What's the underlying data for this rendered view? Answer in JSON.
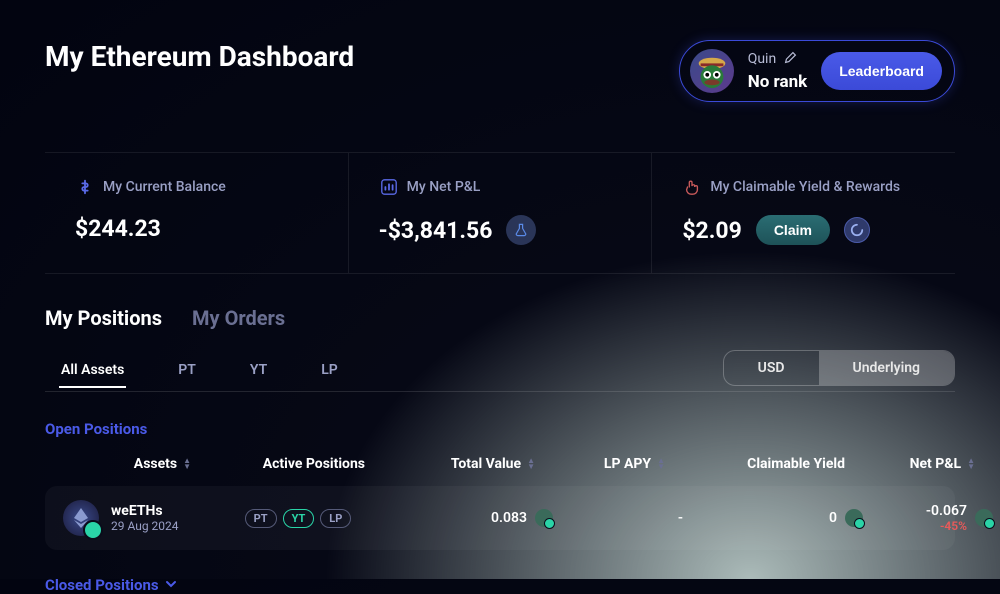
{
  "header": {
    "title": "My Ethereum Dashboard"
  },
  "user": {
    "name": "Quin",
    "rank": "No rank",
    "leaderboard_label": "Leaderboard"
  },
  "stats": {
    "balance_label": "My Current Balance",
    "balance_value": "$244.23",
    "pnl_label": "My Net P&L",
    "pnl_value": "-$3,841.56",
    "claimable_label": "My Claimable Yield & Rewards",
    "claimable_value": "$2.09",
    "claim_button": "Claim"
  },
  "tabs": {
    "positions": "My Positions",
    "orders": "My Orders"
  },
  "asset_filters": {
    "all": "All Assets",
    "pt": "PT",
    "yt": "YT",
    "lp": "LP"
  },
  "unit_toggle": {
    "usd": "USD",
    "underlying": "Underlying"
  },
  "sections": {
    "open": "Open Positions",
    "closed": "Closed Positions"
  },
  "table_headers": {
    "assets": "Assets",
    "active_positions": "Active Positions",
    "total_value": "Total Value",
    "lp_apy": "LP APY",
    "claimable_yield": "Claimable Yield",
    "net_pl": "Net P&L"
  },
  "positions": [
    {
      "name": "weETHs",
      "date": "29 Aug 2024",
      "badges": {
        "pt": "PT",
        "yt": "YT",
        "lp": "LP"
      },
      "total_value": "0.083",
      "lp_apy": "-",
      "claimable_yield": "0",
      "net_pl": "-0.067",
      "net_pl_pct": "-45%"
    }
  ]
}
